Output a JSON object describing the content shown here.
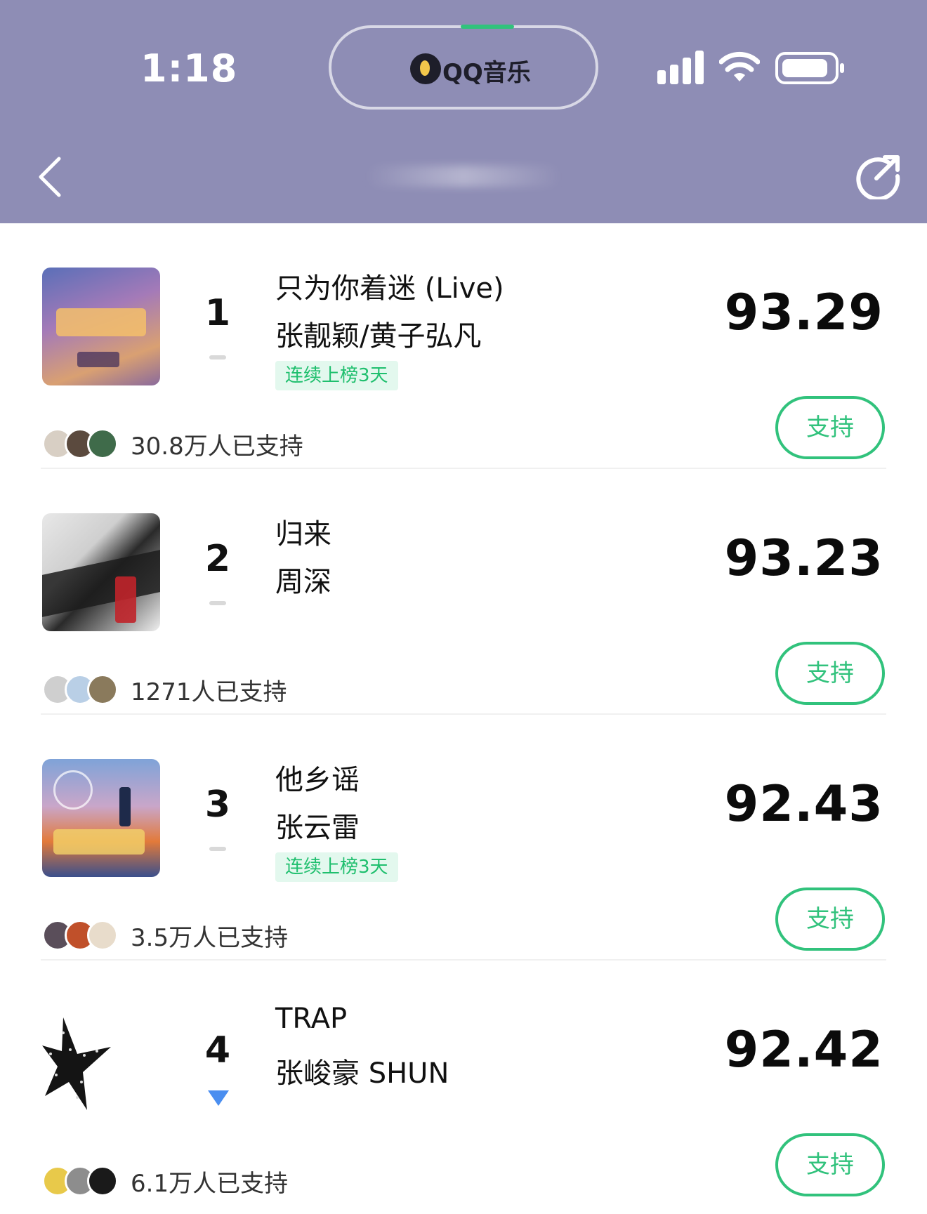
{
  "status_bar": {
    "time": "1:18",
    "island_app": "QQ音乐"
  },
  "nav": {
    "back_icon": "chevron-left-icon",
    "share_icon": "share-icon"
  },
  "colors": {
    "header_bg": "#8e8db5",
    "accent": "#31c27c",
    "badge_bg": "#e3f8ee",
    "trend_down": "#4a8ef0"
  },
  "chart_items": [
    {
      "rank": "1",
      "trend": "flat",
      "song": "只为你着迷 (Live)",
      "artist": "张靓颖/黄子弘凡",
      "badge": "连续上榜3天",
      "score": "93.29",
      "supporters": "30.8万人已支持",
      "support_label": "支持"
    },
    {
      "rank": "2",
      "trend": "flat",
      "song": "归来",
      "artist": "周深",
      "badge": "",
      "score": "93.23",
      "supporters": "1271人已支持",
      "support_label": "支持"
    },
    {
      "rank": "3",
      "trend": "flat",
      "song": "他乡谣",
      "artist": "张云雷",
      "badge": "连续上榜3天",
      "score": "92.43",
      "supporters": "3.5万人已支持",
      "support_label": "支持"
    },
    {
      "rank": "4",
      "trend": "down",
      "song": "TRAP",
      "artist": "张峻豪 SHUN",
      "badge": "",
      "score": "92.42",
      "supporters": "6.1万人已支持",
      "support_label": "支持"
    }
  ]
}
